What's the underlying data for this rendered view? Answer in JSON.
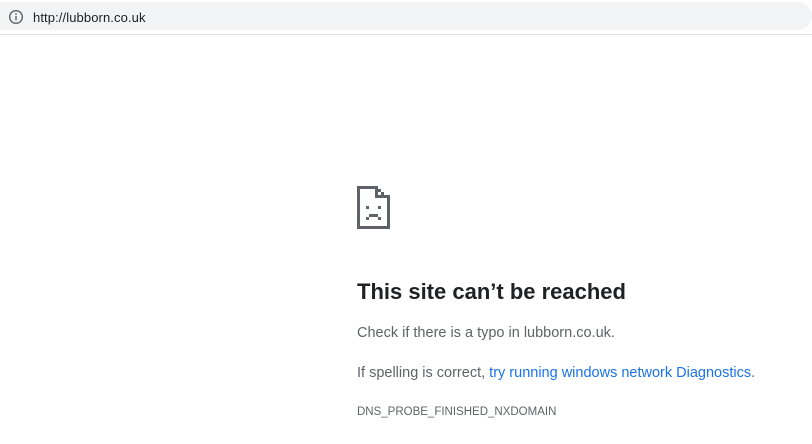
{
  "address_bar": {
    "icon": "info-icon",
    "url": "http://lubborn.co.uk"
  },
  "error_page": {
    "icon": "sad-page-icon",
    "title": "This site can’t be reached",
    "typo_line": "Check if there is a typo in lubborn.co.uk.",
    "spelling_prefix": "If spelling is correct, ",
    "diagnostics_link": "try running windows network Diagnostics",
    "spelling_suffix": ".",
    "error_code": "DNS_PROBE_FINISHED_NXDOMAIN"
  },
  "colors": {
    "link": "#1a73e8",
    "title": "#202124",
    "body_text": "#5f6368",
    "omnibox_bg": "#f1f3f4"
  }
}
